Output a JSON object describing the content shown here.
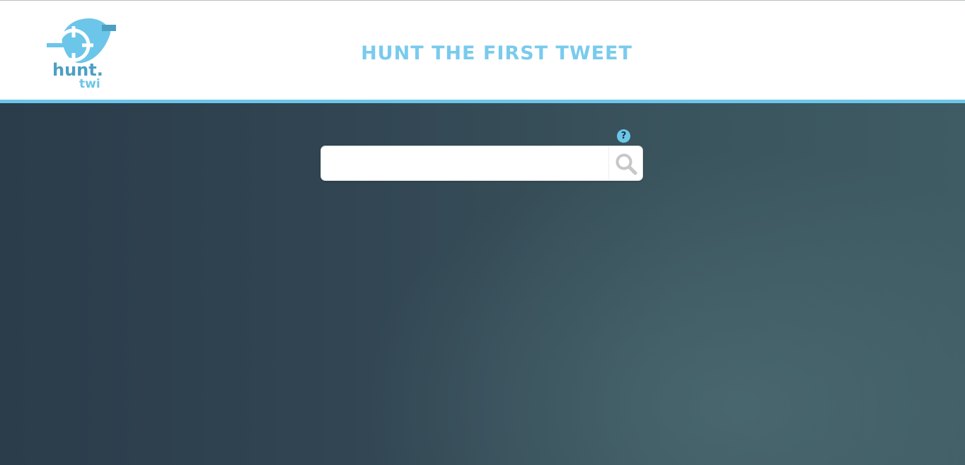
{
  "header": {
    "logo": {
      "icon": "crosshair-bird-logo",
      "word_top": "hunt.",
      "word_bottom": "twi"
    },
    "title": "HUNT THE FIRST TWEET"
  },
  "search": {
    "value": "",
    "placeholder": "",
    "help_label": "?",
    "button_icon": "search-icon"
  },
  "colors": {
    "brand_blue": "#6cc6e9",
    "background_dark": "#2b3c4b",
    "background_light": "#3f5b63"
  }
}
